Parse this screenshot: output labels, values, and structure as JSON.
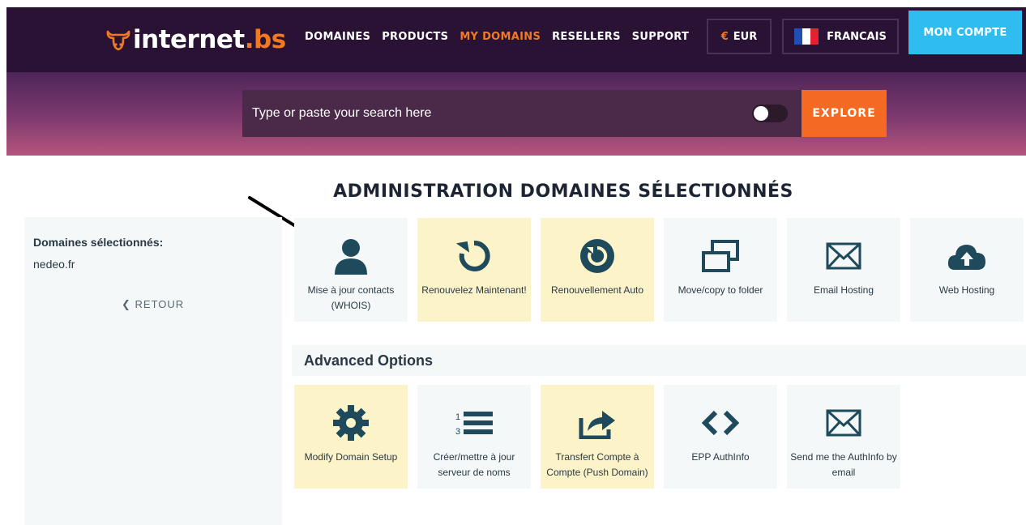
{
  "header": {
    "logo_text": "internet",
    "logo_tld": ".bs",
    "nav": [
      "DOMAINES",
      "PRODUCTS",
      "MY DOMAINS",
      "RESELLERS",
      "SUPPORT"
    ],
    "active_nav": "MY DOMAINS",
    "currency_symbol": "€",
    "currency": "EUR",
    "language": "FRANCAIS",
    "account_button": "MON COMPTE"
  },
  "search": {
    "placeholder": "Type or paste your search here",
    "explore_label": "EXPLORE"
  },
  "page_title": "ADMINISTRATION DOMAINES SÉLECTIONNÉS",
  "sidebar": {
    "label": "Domaines sélectionnés:",
    "domain": "nedeo.fr",
    "back_label": "RETOUR"
  },
  "actions": [
    {
      "label": "Mise à jour contacts (WHOIS)",
      "icon": "user-icon",
      "highlighted": false
    },
    {
      "label": "Renouvelez Maintenant!",
      "icon": "renew-icon",
      "highlighted": true
    },
    {
      "label": "Renouvellement Auto",
      "icon": "auto-renew-icon",
      "highlighted": true
    },
    {
      "label": "Move/copy to folder",
      "icon": "copy-folder-icon",
      "highlighted": false
    },
    {
      "label": "Email Hosting",
      "icon": "envelope-icon",
      "highlighted": false
    },
    {
      "label": "Web Hosting",
      "icon": "cloud-upload-icon",
      "highlighted": false
    }
  ],
  "advanced": {
    "title": "Advanced Options",
    "items": [
      {
        "label": "Modify Domain Setup",
        "icon": "gear-icon",
        "highlighted": true
      },
      {
        "label": "Créer/mettre à jour serveur de noms",
        "icon": "numbered-list-icon",
        "highlighted": false
      },
      {
        "label": "Transfert Compte à Compte (Push Domain)",
        "icon": "share-icon",
        "highlighted": true
      },
      {
        "label": "EPP AuthInfo",
        "icon": "code-icon",
        "highlighted": false
      },
      {
        "label": "Send me the AuthInfo by email",
        "icon": "envelope-icon",
        "highlighted": false
      }
    ]
  },
  "colors": {
    "nav_bg": "#2a1235",
    "accent_orange": "#f56a22",
    "account_blue": "#2fbdf0",
    "icon_teal": "#1e4a5c",
    "tile_highlight": "#fdf3c8",
    "tile_default": "#f4f8f9"
  }
}
